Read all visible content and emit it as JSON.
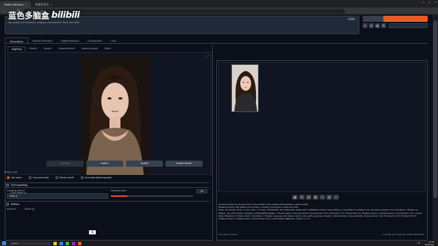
{
  "browser": {
    "tabs": [
      {
        "label": "Stable Diffusion",
        "active": true
      },
      {
        "label": "新建标签页",
        "active": false
      }
    ],
    "url": "127.0.0.1:7860",
    "close_glyph": "×"
  },
  "watermark": {
    "cn": "蓝色多脑盒",
    "logo": "bilibili"
  },
  "prompt": {
    "text": "high quality, low resolution, cropping, monochrome, black and white",
    "token_count": "0/75"
  },
  "main_tabs": [
    "Generation",
    "Textual Inversion",
    "Hypernetworks",
    "Checkpoints",
    "Lora"
  ],
  "sub_tabs": [
    "img2img",
    "Sketch",
    "Inpaint",
    "Inpaint sketch",
    "Inpaint upload",
    "Batch"
  ],
  "copy_image": {
    "label": "Copy image to:",
    "buttons": [
      "img2img",
      "sketch",
      "inpaint",
      "inpaint sketch"
    ]
  },
  "resize_mode": {
    "label": "Resize mode",
    "options": [
      "Just resize",
      "Crop and resize",
      "Resize and fill",
      "Just resize (latent upscale)"
    ],
    "selected": 0
  },
  "soft_inpainting": "Soft inpainting",
  "sampler": {
    "label": "Sampling method",
    "value": "Euler a"
  },
  "steps": {
    "label": "Sampling steps",
    "value": "20",
    "fraction": 0.2
  },
  "refiner": "Refiner",
  "resize_to": {
    "tab1": "Resize to",
    "tab2": "Resize by"
  },
  "output": {
    "toolbar_icons": [
      "folder-icon",
      "save-icon",
      "zip-icon",
      "image-icon",
      "palette-icon",
      "extras-icon",
      "star-icon"
    ],
    "info_lines": [
      "full body portrait of a young woman in the wooden house adapter-based glasses, solid, beautiful",
      "Negative prompt: high quality, low resolution, cropping, monochrome, black and white",
      "Steps: 20, Sampler: Euler a, CFG scale: 7.5, Seed: 1402334436, Size: 800x1422, Model hash: 47d50d5ce4, Model: dreamshaper_8, ControlNet 0: Enabled: True, Denoising strength: 0.5, ControlNet 0: \"Module: ip-adapter_clip_sd15, Model: ip-adapter_sd15 [6a3f8b], Weight: 1, Resize Mode: Crop and Resize, Processor Res: 512, Threshold A: 0.5, Threshold B: 0.5, Guidance Start: 0, Guidance End: 1, Pixel Perfect: True, Control Mode: Balanced, Hr Option: Both\", ControlNet 1: \"Module: openpose_full, Model: control_v11p_sd15_openpose, Weight: 1, Resize Mode: Crop and Resize, Processor Res: 512, Threshold A: 0.5, Threshold B: 0.5, Guidance Start: 0, Guidance End: 1, Pixel Perfect: True, Control Mode: Balanced\", Version: v1.7.0"
    ],
    "time_taken": "Time taken: 41.8 sec.",
    "vram": "A: 4.9 GB, R: 6.1 GB, Sys: 6.8/8.0 GB (85.5%)"
  },
  "taskbar": {
    "search_placeholder": "Search",
    "ime": "英",
    "clock_time": "16:58",
    "clock_date": "2024/4/22",
    "tray": "^ 中"
  },
  "colors": {
    "accent": "#e85a2c",
    "bg": "#0b0f19",
    "panel": "#1f2937"
  }
}
